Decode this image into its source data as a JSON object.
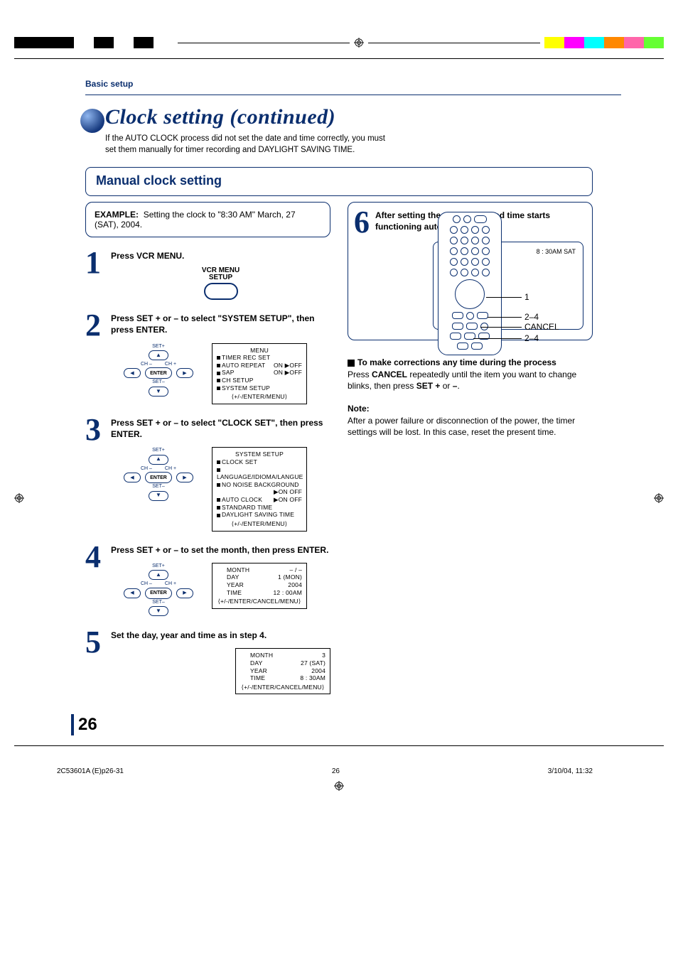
{
  "colorbars": {
    "left": [
      "#000000",
      "#000000",
      "#000000",
      "#ffffff",
      "#000000",
      "#ffffff",
      "#000000",
      "#ffffff"
    ],
    "right": [
      "#ffff00",
      "#ff00ff",
      "#00ffff",
      "#ff8800",
      "#ff66aa",
      "#66ff33"
    ]
  },
  "header": {
    "section": "Basic setup"
  },
  "title": "Clock setting (continued)",
  "intro": "If the AUTO CLOCK process did not set the date and time correctly, you must set them manually for timer recording and DAYLIGHT SAVING TIME.",
  "remote_labels": {
    "a": "1",
    "b": "2–4",
    "c": "CANCEL",
    "d": "2–4"
  },
  "section_title": "Manual clock setting",
  "example": {
    "label": "EXAMPLE:",
    "text": "Setting the clock to \"8:30 AM\" March, 27 (SAT), 2004."
  },
  "steps": {
    "s1": {
      "num": "1",
      "line1": "Press VCR MENU.",
      "btn_top": "VCR MENU",
      "btn_bottom": "SETUP"
    },
    "s2": {
      "num": "2",
      "line1_a": "Press SET + or – to select ",
      "line1_b": "\"SYSTEM SETUP\"",
      "line1_c": ", then press  ENTER.",
      "kp": {
        "setplus": "SET+",
        "setminus": "SET–",
        "chminus": "CH –",
        "chplus": "CH +",
        "enter": "ENTER"
      },
      "osd": {
        "title": "MENU",
        "rows": [
          {
            "l": "TIMER REC SET",
            "r": ""
          },
          {
            "l": "AUTO REPEAT",
            "r": "ON ▶OFF"
          },
          {
            "l": "SAP",
            "r": "ON ▶OFF"
          },
          {
            "l": "CH SETUP",
            "r": ""
          },
          {
            "l": "SYSTEM SETUP",
            "r": ""
          }
        ],
        "foot": "⟨+/-/ENTER/MENU⟩"
      }
    },
    "s3": {
      "num": "3",
      "line1_a": "Press SET + or – to select ",
      "line1_b": "\"CLOCK SET\"",
      "line1_c": ", then press  ENTER.",
      "osd": {
        "title": "SYSTEM SETUP",
        "rows": [
          {
            "l": "CLOCK SET",
            "r": ""
          },
          {
            "l": "LANGUAGE/IDIOMA/LANGUE",
            "r": ""
          },
          {
            "l": "NO NOISE BACKGROUND",
            "r": ""
          },
          {
            "l": "",
            "r": "▶ON   OFF"
          },
          {
            "l": "AUTO CLOCK",
            "r": "▶ON   OFF"
          },
          {
            "l": "STANDARD TIME",
            "r": ""
          },
          {
            "l": "DAYLIGHT SAVING TIME",
            "r": ""
          }
        ],
        "foot": "⟨+/-/ENTER/MENU⟩"
      }
    },
    "s4": {
      "num": "4",
      "line1": "Press SET + or – to set the month, then press ENTER.",
      "osd": {
        "rows": [
          {
            "l": "MONTH",
            "r": "– / –"
          },
          {
            "l": "DAY",
            "r": "1 (MON)"
          },
          {
            "l": "YEAR",
            "r": "2004"
          },
          {
            "l": "TIME",
            "r": "12 : 00AM"
          }
        ],
        "foot": "⟨+/-/ENTER/CANCEL/MENU⟩"
      }
    },
    "s5": {
      "num": "5",
      "line1": "Set the day, year and time as in step 4.",
      "osd": {
        "rows": [
          {
            "l": "MONTH",
            "r": "3"
          },
          {
            "l": "DAY",
            "r": "27 (SAT)"
          },
          {
            "l": "YEAR",
            "r": "2004"
          },
          {
            "l": "TIME",
            "r": "8 : 30AM"
          }
        ],
        "foot": "⟨+/-/ENTER/CANCEL/MENU⟩"
      }
    },
    "s6": {
      "num": "6",
      "line1": "After setting the clock, date and time starts functioning automatically.",
      "tv": "8 : 30AM   SAT"
    }
  },
  "corrections": {
    "heading": "To make corrections any time during the process",
    "body_a": "Press ",
    "body_b": "CANCEL",
    "body_c": " repeatedly until the item you want to change blinks, then press ",
    "body_d": "SET +",
    "body_e": " or ",
    "body_f": "–",
    "body_g": "."
  },
  "note": {
    "heading": "Note:",
    "body": "After a power failure or disconnection of the power, the timer settings will be lost. In this case, reset the present time."
  },
  "page_number": "26",
  "footer": {
    "left": "2C53601A (E)p26-31",
    "center": "26",
    "right": "3/10/04, 11:32"
  }
}
